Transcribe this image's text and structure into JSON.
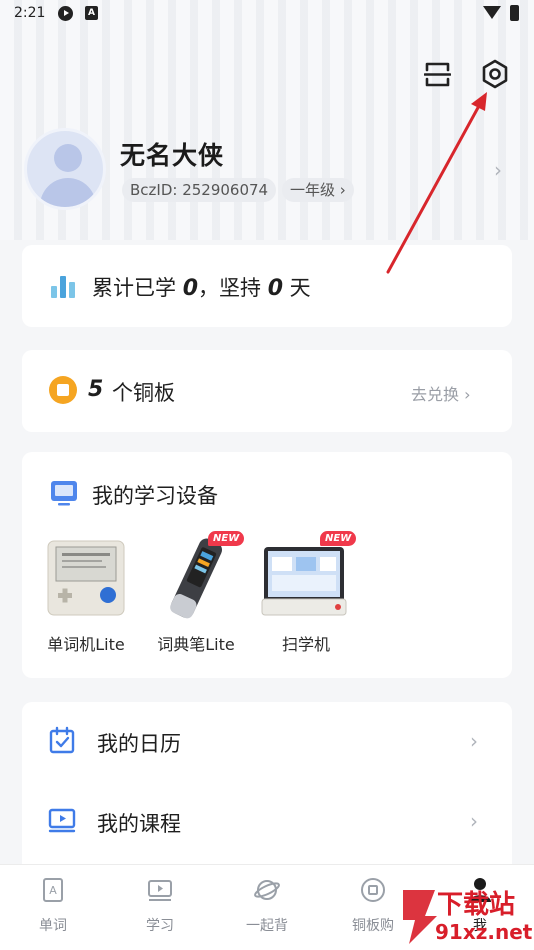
{
  "status_bar": {
    "time": "2:21",
    "icons": [
      "play-icon",
      "a-icon",
      "wifi-icon",
      "battery-icon"
    ]
  },
  "header": {
    "icons": [
      "scan-icon",
      "settings-icon"
    ]
  },
  "profile": {
    "nickname": "无名大侠",
    "bczid": "BczID: 252906074",
    "grade": "一年级 ›",
    "chevron": "›"
  },
  "stats": {
    "prefix": "累计已学 ",
    "learned": "0",
    "middle": "，坚持 ",
    "days": "0",
    "suffix": " 天"
  },
  "coins": {
    "count": "5",
    "label": "个铜板",
    "exchange": "去兑换 ›"
  },
  "devices": {
    "title": "我的学习设备",
    "items": [
      {
        "label": "单词机Lite",
        "badge": ""
      },
      {
        "label": "词典笔Lite",
        "badge": "NEW"
      },
      {
        "label": "扫学机",
        "badge": "NEW"
      }
    ]
  },
  "menu": {
    "items": [
      {
        "label": "我的日历",
        "chevron": "›"
      },
      {
        "label": "我的课程",
        "chevron": "›"
      }
    ]
  },
  "tabbar": {
    "items": [
      {
        "label": "单词"
      },
      {
        "label": "学习"
      },
      {
        "label": "一起背"
      },
      {
        "label": "铜板购"
      },
      {
        "label": "我"
      }
    ],
    "active": "我"
  },
  "watermark": {
    "line1": "下载站",
    "line2": "91xz.net"
  },
  "colors": {
    "accent_blue": "#3f7be8",
    "coin_orange": "#f5a522",
    "badge_red": "#f0394b",
    "annotation_red": "#d8262c"
  }
}
